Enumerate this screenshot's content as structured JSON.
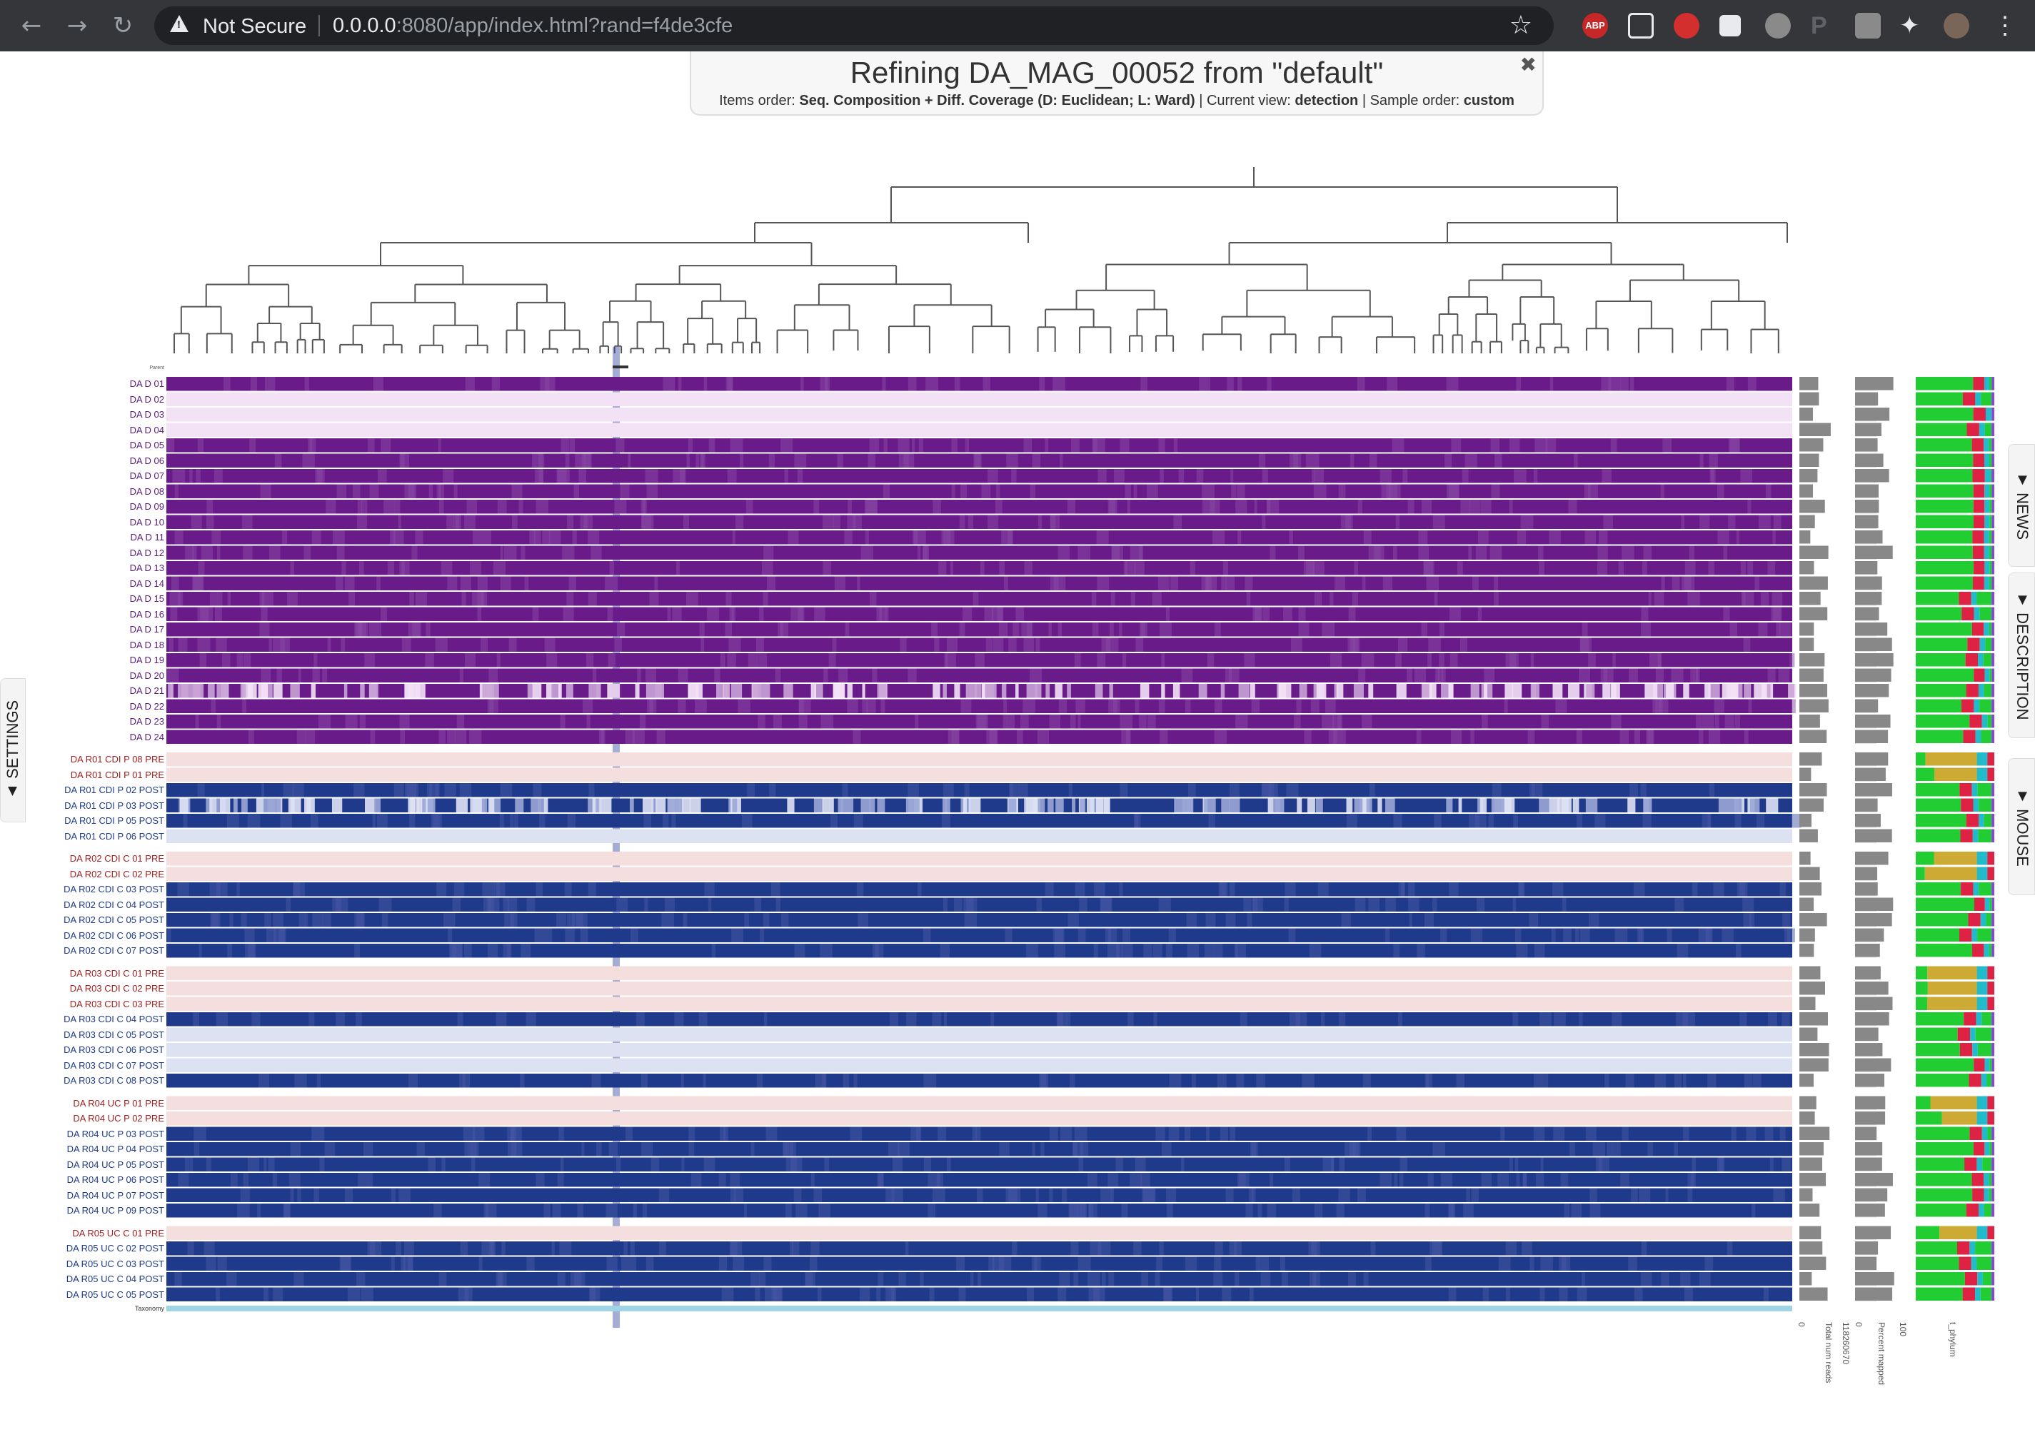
{
  "browser": {
    "security_label": "Not Secure",
    "url_host": "0.0.0.0",
    "url_rest": ":8080/app/index.html?rand=f4de3cfe",
    "extensions": [
      "abp-icon",
      "grammarly-icon",
      "hand-icon",
      "square-icon",
      "pen-icon",
      "p-icon",
      "v-icon",
      "puzzle-icon",
      "avatar",
      "menu-icon"
    ]
  },
  "refine": {
    "title": "Refining DA_MAG_00052 from \"default\"",
    "items_order_label": "Items order: ",
    "items_order_value": "Seq. Composition + Diff. Coverage (D: Euclidean; L: Ward)",
    "view_label": " | Current view: ",
    "view_value": "detection",
    "sample_label": " | Sample order: ",
    "sample_value": "custom",
    "close": "✖"
  },
  "tabs": {
    "settings": "▲ SETTINGS",
    "news": "▼ NEWS",
    "description": "▼ DESCRIPTION",
    "mouse": "▼ MOUSE"
  },
  "colors": {
    "dad": "#6a1b8a",
    "dad_light": "#f3e1f6",
    "post": "#1f3a8a",
    "pre": "#f5dede",
    "post_label": "#1f3a8a",
    "pre_label": "#a02020",
    "dad_label": "#5a1a7a",
    "taxonomy": "#9fd3e6",
    "selection": "#3a4aa0"
  },
  "samples": [
    {
      "group": "dad",
      "rows": [
        {
          "label": "DA D 01",
          "state": "full"
        },
        {
          "label": "DA D 02",
          "state": "light"
        },
        {
          "label": "DA D 03",
          "state": "light"
        },
        {
          "label": "DA D 04",
          "state": "light"
        },
        {
          "label": "DA D 05",
          "state": "full"
        },
        {
          "label": "DA D 06",
          "state": "full"
        },
        {
          "label": "DA D 07",
          "state": "full"
        },
        {
          "label": "DA D 08",
          "state": "full"
        },
        {
          "label": "DA D 09",
          "state": "full"
        },
        {
          "label": "DA D 10",
          "state": "full"
        },
        {
          "label": "DA D 11",
          "state": "full"
        },
        {
          "label": "DA D 12",
          "state": "full"
        },
        {
          "label": "DA D 13",
          "state": "full"
        },
        {
          "label": "DA D 14",
          "state": "full"
        },
        {
          "label": "DA D 15",
          "state": "full"
        },
        {
          "label": "DA D 16",
          "state": "full"
        },
        {
          "label": "DA D 17",
          "state": "full"
        },
        {
          "label": "DA D 18",
          "state": "full"
        },
        {
          "label": "DA D 19",
          "state": "full"
        },
        {
          "label": "DA D 20",
          "state": "full"
        },
        {
          "label": "DA D 21",
          "state": "mixed"
        },
        {
          "label": "DA D 22",
          "state": "full"
        },
        {
          "label": "DA D 23",
          "state": "full"
        },
        {
          "label": "DA D 24",
          "state": "full"
        }
      ]
    },
    {
      "group": "r01",
      "rows": [
        {
          "label": "DA R01 CDI P 08 PRE",
          "state": "pre"
        },
        {
          "label": "DA R01 CDI P 01 PRE",
          "state": "pre"
        },
        {
          "label": "DA R01 CDI P 02 POST",
          "state": "full"
        },
        {
          "label": "DA R01 CDI P 03 POST",
          "state": "mixed"
        },
        {
          "label": "DA R01 CDI P 05 POST",
          "state": "full"
        },
        {
          "label": "DA R01 CDI P 06 POST",
          "state": "light"
        }
      ]
    },
    {
      "group": "r02",
      "rows": [
        {
          "label": "DA R02 CDI C 01 PRE",
          "state": "pre"
        },
        {
          "label": "DA R02 CDI C 02 PRE",
          "state": "pre"
        },
        {
          "label": "DA R02 CDI C 03 POST",
          "state": "full"
        },
        {
          "label": "DA R02 CDI C 04 POST",
          "state": "full"
        },
        {
          "label": "DA R02 CDI C 05 POST",
          "state": "full"
        },
        {
          "label": "DA R02 CDI C 06 POST",
          "state": "full"
        },
        {
          "label": "DA R02 CDI C 07 POST",
          "state": "full"
        }
      ]
    },
    {
      "group": "r03",
      "rows": [
        {
          "label": "DA R03 CDI C 01 PRE",
          "state": "pre"
        },
        {
          "label": "DA R03 CDI C 02 PRE",
          "state": "pre"
        },
        {
          "label": "DA R03 CDI C 03 PRE",
          "state": "pre"
        },
        {
          "label": "DA R03 CDI C 04 POST",
          "state": "full"
        },
        {
          "label": "DA R03 CDI C 05 POST",
          "state": "light"
        },
        {
          "label": "DA R03 CDI C 06 POST",
          "state": "light"
        },
        {
          "label": "DA R03 CDI C 07 POST",
          "state": "light"
        },
        {
          "label": "DA R03 CDI C 08 POST",
          "state": "full"
        }
      ]
    },
    {
      "group": "r04",
      "rows": [
        {
          "label": "DA R04 UC P 01 PRE",
          "state": "pre"
        },
        {
          "label": "DA R04 UC P 02 PRE",
          "state": "pre"
        },
        {
          "label": "DA R04 UC P 03 POST",
          "state": "full"
        },
        {
          "label": "DA R04 UC P 04 POST",
          "state": "full"
        },
        {
          "label": "DA R04 UC P 05 POST",
          "state": "full"
        },
        {
          "label": "DA R04 UC P 06 POST",
          "state": "full"
        },
        {
          "label": "DA R04 UC P 07 POST",
          "state": "full"
        },
        {
          "label": "DA R04 UC P 09 POST",
          "state": "full"
        }
      ]
    },
    {
      "group": "r05",
      "rows": [
        {
          "label": "DA R05 UC C 01 PRE",
          "state": "pre"
        },
        {
          "label": "DA R05 UC C 02 POST",
          "state": "full"
        },
        {
          "label": "DA R05 UC C 03 POST",
          "state": "full"
        },
        {
          "label": "DA R05 UC C 04 POST",
          "state": "full"
        },
        {
          "label": "DA R05 UC C 05 POST",
          "state": "full"
        }
      ]
    }
  ],
  "bottom_labels": {
    "taxonomy": "Taxonomy",
    "parent": "Parent"
  },
  "layers": {
    "total_num_reads": {
      "label": "Total num reads",
      "min": "0",
      "max": "118260670"
    },
    "percent_mapped": {
      "label": "Percent mapped",
      "min": "0",
      "max": "100"
    },
    "phylum": {
      "label": "t_phylum"
    }
  }
}
